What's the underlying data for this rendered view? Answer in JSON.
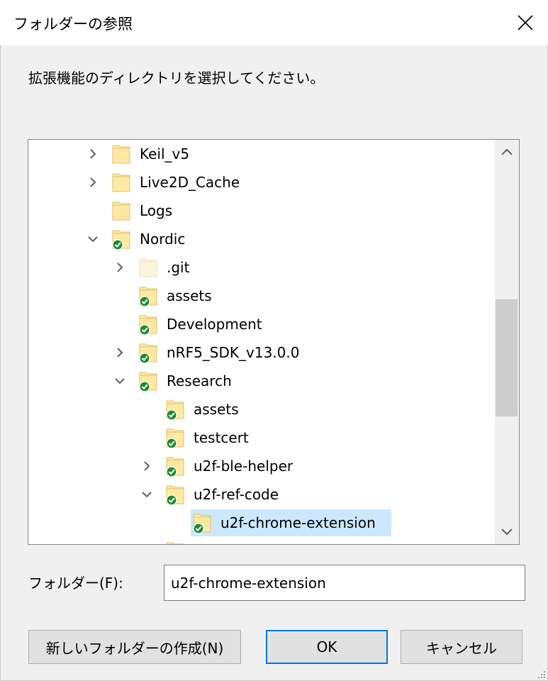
{
  "window": {
    "title": "フォルダーの参照",
    "close_icon": "close-icon"
  },
  "instruction": "拡張機能のディレクトリを選択してください。",
  "tree": {
    "items": [
      {
        "label": "Keil_v5",
        "expander": "collapsed",
        "synced": false,
        "hidden": false,
        "selected": false
      },
      {
        "label": "Live2D_Cache",
        "expander": "collapsed",
        "synced": false,
        "hidden": false,
        "selected": false
      },
      {
        "label": "Logs",
        "expander": "none",
        "synced": false,
        "hidden": false,
        "selected": false
      },
      {
        "label": "Nordic",
        "expander": "expanded",
        "synced": true,
        "hidden": false,
        "selected": false
      },
      {
        "label": ".git",
        "expander": "collapsed",
        "synced": false,
        "hidden": true,
        "selected": false
      },
      {
        "label": "assets",
        "expander": "none",
        "synced": true,
        "hidden": false,
        "selected": false
      },
      {
        "label": "Development",
        "expander": "none",
        "synced": true,
        "hidden": false,
        "selected": false
      },
      {
        "label": "nRF5_SDK_v13.0.0",
        "expander": "collapsed",
        "synced": true,
        "hidden": false,
        "selected": false
      },
      {
        "label": "Research",
        "expander": "expanded",
        "synced": true,
        "hidden": false,
        "selected": false
      },
      {
        "label": "assets",
        "expander": "none",
        "synced": true,
        "hidden": false,
        "selected": false
      },
      {
        "label": "testcert",
        "expander": "none",
        "synced": true,
        "hidden": false,
        "selected": false
      },
      {
        "label": "u2f-ble-helper",
        "expander": "collapsed",
        "synced": true,
        "hidden": false,
        "selected": false
      },
      {
        "label": "u2f-ref-code",
        "expander": "expanded",
        "synced": true,
        "hidden": false,
        "selected": false
      },
      {
        "label": "u2f-chrome-extension",
        "expander": "none",
        "synced": true,
        "hidden": false,
        "selected": true
      }
    ]
  },
  "folder_field": {
    "label": "フォルダー(F):",
    "value": "u2f-chrome-extension"
  },
  "buttons": {
    "new_folder": "新しいフォルダーの作成(N)",
    "ok": "OK",
    "cancel": "キャンセル"
  },
  "colors": {
    "accent": "#0078d7",
    "selection": "#cce8ff",
    "folder": "#ffe9a2",
    "sync_check": "#1e8b2e"
  }
}
